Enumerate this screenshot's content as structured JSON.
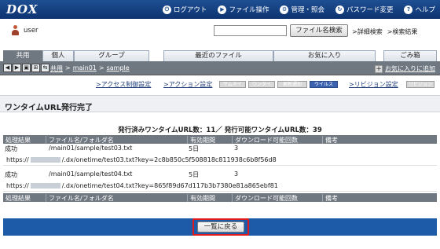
{
  "app": {
    "logo": "DOX"
  },
  "topnav": [
    {
      "label": "ログアウト",
      "icon": "logout-icon"
    },
    {
      "label": "ファイル操作",
      "icon": "file-ops-icon"
    },
    {
      "label": "管理・照会",
      "icon": "admin-icon"
    },
    {
      "label": "パスワード変更",
      "icon": "password-icon"
    },
    {
      "label": "ヘルプ",
      "icon": "help-icon"
    }
  ],
  "user": {
    "name": "user"
  },
  "search": {
    "button_label": "ファイル名検索",
    "placeholder": "",
    "links": [
      ">詳細検索",
      ">検索結果"
    ]
  },
  "tabs": [
    "共用",
    "個人",
    "グループ",
    "最近のファイル",
    "お気に入り",
    "ごみ箱"
  ],
  "breadcrumb": {
    "items": [
      "共用",
      "main01",
      "sample"
    ],
    "separator": ">",
    "fav_add": "お気に入りに追加"
  },
  "settings": {
    "links": [
      ">アクセス制御設定",
      ">アクション設定",
      ">リビジョン設定"
    ],
    "pills": [
      "サムネイル",
      "ワンタイム",
      "更新通知",
      "ウイルス",
      "リビジョン"
    ],
    "active_pill": "ウイルス"
  },
  "page": {
    "title": "ワンタイムURL発行完了",
    "count_text": "発行済みワンタイムURL数：11／ 発行可能ワンタイムURL数：39"
  },
  "table": {
    "headers": [
      "処理結果",
      "ファイル名/フォルダ名",
      "有効期間",
      "ダウンロード可能回数",
      "備考"
    ],
    "rows": [
      {
        "result": "成功",
        "path": "/main01/sample/test03.txt",
        "period": "5日",
        "downloads": "3",
        "note": "",
        "url_prefix": "https://",
        "url_suffix": "/.dx/onetime/test03.txt?key=2c8b850c5f508818c811938c6b8f56d8"
      },
      {
        "result": "成功",
        "path": "/main01/sample/test04.txt",
        "period": "5日",
        "downloads": "3",
        "note": "",
        "url_prefix": "https://",
        "url_suffix": "/.dx/onetime/test04.txt?key=865f89d67d117b3b7380e81a865ebf81"
      }
    ]
  },
  "footer": {
    "back_label": "一覧に戻る"
  },
  "colors": {
    "header": "#1d4f93",
    "tab_active": "#6f7780",
    "bottom_bar": "#1d5aa7",
    "highlight": "#e01a1a"
  }
}
